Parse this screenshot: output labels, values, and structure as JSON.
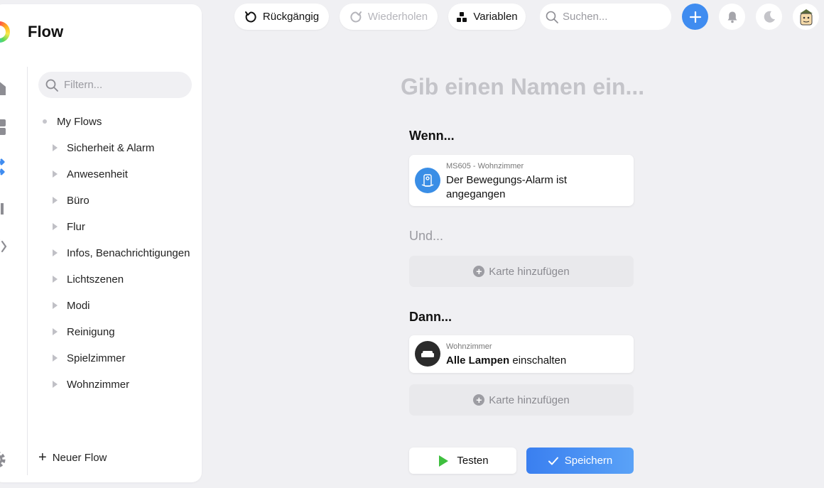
{
  "app": {
    "title": "Flow"
  },
  "colors": {
    "accent": "#3f8cf0",
    "play": "#3fbf3f",
    "trigger_icon_bg": "#3a8ee6",
    "action_icon_bg": "#2b2b2b"
  },
  "toolbar": {
    "undo_label": "Rückgängig",
    "redo_label": "Wiederholen",
    "variables_label": "Variablen",
    "search_placeholder": "Suchen..."
  },
  "sidebar": {
    "filter_placeholder": "Filtern...",
    "root_label": "My Flows",
    "items": [
      "Sicherheit & Alarm",
      "Anwesenheit",
      "Büro",
      "Flur",
      "Infos, Benachrichtigungen",
      "Lichtszenen",
      "Modi",
      "Reinigung",
      "Spielzimmer",
      "Wohnzimmer"
    ],
    "new_flow_label": "Neuer Flow"
  },
  "editor": {
    "name_placeholder": "Gib einen Namen ein...",
    "when_label": "Wenn...",
    "and_label": "Und...",
    "then_label": "Dann...",
    "add_card_label": "Karte hinzufügen",
    "trigger": {
      "device": "MS605 - Wohnzimmer",
      "text": "Der Bewegungs-Alarm ist angegangen"
    },
    "action": {
      "zone": "Wohnzimmer",
      "bold": "Alle Lampen",
      "rest": " einschalten"
    },
    "test_label": "Testen",
    "save_label": "Speichern"
  }
}
